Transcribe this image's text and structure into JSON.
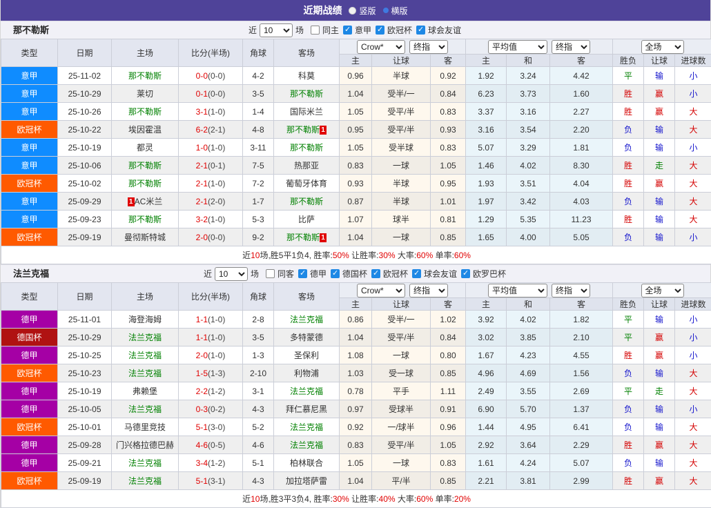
{
  "topbar": {
    "title": "近期战绩",
    "radios": [
      {
        "label": "竖版",
        "checked": false
      },
      {
        "label": "横版",
        "checked": true
      }
    ]
  },
  "colors": {
    "topbar_bg": "#4F4399",
    "comp": {
      "意甲": "#0F8CFF",
      "欧冠杯": "#FF5A00",
      "德甲": "#A500A5",
      "德国杯": "#B01212"
    },
    "win_red": "#D40000",
    "lose_blue": "#1414CC",
    "draw_green": "#008000",
    "focus_team_green": "#008000",
    "score_red": "#E00000",
    "checkbox_blue": "#1E88E5"
  },
  "table_header": {
    "cols": [
      "类型",
      "日期",
      "主场",
      "比分(半场)",
      "角球",
      "客场"
    ],
    "crow_selects": [
      "Crow*",
      "终指"
    ],
    "avg_selects": [
      "平均值",
      "终指"
    ],
    "scope_select": "全场",
    "sub": [
      "主",
      "让球",
      "客",
      "主",
      "和",
      "客",
      "胜负",
      "让球",
      "进球数"
    ]
  },
  "sections": [
    {
      "team": "那不勒斯",
      "filter": {
        "near_label": "近",
        "count": "10",
        "games_label": "场",
        "checkboxes": [
          {
            "label": "同主",
            "checked": false
          },
          {
            "label": "意甲",
            "checked": true
          },
          {
            "label": "欧冠杯",
            "checked": true
          },
          {
            "label": "球会友谊",
            "checked": true
          }
        ]
      },
      "rows": [
        {
          "comp": "意甲",
          "date": "25-11-02",
          "home": {
            "name": "那不勒斯",
            "focus": true
          },
          "score": "0-0",
          "half": "(0-0)",
          "corner": "4-2",
          "away": {
            "name": "科莫"
          },
          "crow": [
            "0.96",
            "半球",
            "0.92"
          ],
          "avg": [
            "1.92",
            "3.24",
            "4.42"
          ],
          "res": [
            [
              "平",
              "g"
            ],
            [
              "输",
              "b"
            ],
            [
              "小",
              "b"
            ]
          ]
        },
        {
          "comp": "意甲",
          "date": "25-10-29",
          "home": {
            "name": "莱切"
          },
          "score": "0-1",
          "half": "(0-0)",
          "corner": "3-5",
          "away": {
            "name": "那不勒斯",
            "focus": true
          },
          "crow": [
            "1.04",
            "受半/一",
            "0.84"
          ],
          "avg": [
            "6.23",
            "3.73",
            "1.60"
          ],
          "res": [
            [
              "胜",
              "r"
            ],
            [
              "赢",
              "r"
            ],
            [
              "小",
              "b"
            ]
          ]
        },
        {
          "comp": "意甲",
          "date": "25-10-26",
          "home": {
            "name": "那不勒斯",
            "focus": true
          },
          "score": "3-1",
          "half": "(1-0)",
          "corner": "1-4",
          "away": {
            "name": "国际米兰"
          },
          "crow": [
            "1.05",
            "受平/半",
            "0.83"
          ],
          "avg": [
            "3.37",
            "3.16",
            "2.27"
          ],
          "res": [
            [
              "胜",
              "r"
            ],
            [
              "赢",
              "r"
            ],
            [
              "大",
              "r"
            ]
          ]
        },
        {
          "comp": "欧冠杯",
          "date": "25-10-22",
          "home": {
            "name": "埃因霍温"
          },
          "score": "6-2",
          "half": "(2-1)",
          "corner": "4-8",
          "away": {
            "name": "那不勒斯",
            "focus": true,
            "card": "1",
            "card_pos": "right"
          },
          "crow": [
            "0.95",
            "受平/半",
            "0.93"
          ],
          "avg": [
            "3.16",
            "3.54",
            "2.20"
          ],
          "res": [
            [
              "负",
              "b"
            ],
            [
              "输",
              "b"
            ],
            [
              "大",
              "r"
            ]
          ]
        },
        {
          "comp": "意甲",
          "date": "25-10-19",
          "home": {
            "name": "都灵"
          },
          "score": "1-0",
          "half": "(1-0)",
          "corner": "3-11",
          "away": {
            "name": "那不勒斯",
            "focus": true
          },
          "crow": [
            "1.05",
            "受半球",
            "0.83"
          ],
          "avg": [
            "5.07",
            "3.29",
            "1.81"
          ],
          "res": [
            [
              "负",
              "b"
            ],
            [
              "输",
              "b"
            ],
            [
              "小",
              "b"
            ]
          ]
        },
        {
          "comp": "意甲",
          "date": "25-10-06",
          "home": {
            "name": "那不勒斯",
            "focus": true
          },
          "score": "2-1",
          "half": "(0-1)",
          "corner": "7-5",
          "away": {
            "name": "热那亚"
          },
          "crow": [
            "0.83",
            "一球",
            "1.05"
          ],
          "avg": [
            "1.46",
            "4.02",
            "8.30"
          ],
          "res": [
            [
              "胜",
              "r"
            ],
            [
              "走",
              "g"
            ],
            [
              "大",
              "r"
            ]
          ]
        },
        {
          "comp": "欧冠杯",
          "date": "25-10-02",
          "home": {
            "name": "那不勒斯",
            "focus": true
          },
          "score": "2-1",
          "half": "(1-0)",
          "corner": "7-2",
          "away": {
            "name": "葡萄牙体育"
          },
          "crow": [
            "0.93",
            "半球",
            "0.95"
          ],
          "avg": [
            "1.93",
            "3.51",
            "4.04"
          ],
          "res": [
            [
              "胜",
              "r"
            ],
            [
              "赢",
              "r"
            ],
            [
              "大",
              "r"
            ]
          ]
        },
        {
          "comp": "意甲",
          "date": "25-09-29",
          "home": {
            "name": "AC米兰",
            "card": "1",
            "card_pos": "left"
          },
          "score": "2-1",
          "half": "(2-0)",
          "corner": "1-7",
          "away": {
            "name": "那不勒斯",
            "focus": true
          },
          "crow": [
            "0.87",
            "半球",
            "1.01"
          ],
          "avg": [
            "1.97",
            "3.42",
            "4.03"
          ],
          "res": [
            [
              "负",
              "b"
            ],
            [
              "输",
              "b"
            ],
            [
              "大",
              "r"
            ]
          ]
        },
        {
          "comp": "意甲",
          "date": "25-09-23",
          "home": {
            "name": "那不勒斯",
            "focus": true
          },
          "score": "3-2",
          "half": "(1-0)",
          "corner": "5-3",
          "away": {
            "name": "比萨"
          },
          "crow": [
            "1.07",
            "球半",
            "0.81"
          ],
          "avg": [
            "1.29",
            "5.35",
            "11.23"
          ],
          "res": [
            [
              "胜",
              "r"
            ],
            [
              "输",
              "b"
            ],
            [
              "大",
              "r"
            ]
          ]
        },
        {
          "comp": "欧冠杯",
          "date": "25-09-19",
          "home": {
            "name": "曼彻斯特城"
          },
          "score": "2-0",
          "half": "(0-0)",
          "corner": "9-2",
          "away": {
            "name": "那不勒斯",
            "focus": true,
            "card": "1",
            "card_pos": "right"
          },
          "crow": [
            "1.04",
            "一球",
            "0.85"
          ],
          "avg": [
            "1.65",
            "4.00",
            "5.05"
          ],
          "res": [
            [
              "负",
              "b"
            ],
            [
              "输",
              "b"
            ],
            [
              "小",
              "b"
            ]
          ]
        }
      ],
      "summary": [
        {
          "t": "近"
        },
        {
          "t": "10",
          "r": true
        },
        {
          "t": "场,胜5平1负4, 胜率:"
        },
        {
          "t": "50%",
          "r": true
        },
        {
          "t": " 让胜率:"
        },
        {
          "t": "30%",
          "r": true
        },
        {
          "t": " 大率:"
        },
        {
          "t": "60%",
          "r": true
        },
        {
          "t": " 单率:"
        },
        {
          "t": "60%",
          "r": true
        }
      ]
    },
    {
      "team": "法兰克福",
      "filter": {
        "near_label": "近",
        "count": "10",
        "games_label": "场",
        "checkboxes": [
          {
            "label": "同客",
            "checked": false
          },
          {
            "label": "德甲",
            "checked": true
          },
          {
            "label": "德国杯",
            "checked": true
          },
          {
            "label": "欧冠杯",
            "checked": true
          },
          {
            "label": "球会友谊",
            "checked": true
          },
          {
            "label": "欧罗巴杯",
            "checked": true
          }
        ]
      },
      "rows": [
        {
          "comp": "德甲",
          "date": "25-11-01",
          "home": {
            "name": "海登海姆"
          },
          "score": "1-1",
          "half": "(1-0)",
          "corner": "2-8",
          "away": {
            "name": "法兰克福",
            "focus": true
          },
          "crow": [
            "0.86",
            "受半/一",
            "1.02"
          ],
          "avg": [
            "3.92",
            "4.02",
            "1.82"
          ],
          "res": [
            [
              "平",
              "g"
            ],
            [
              "输",
              "b"
            ],
            [
              "小",
              "b"
            ]
          ]
        },
        {
          "comp": "德国杯",
          "date": "25-10-29",
          "home": {
            "name": "法兰克福",
            "focus": true
          },
          "score": "1-1",
          "half": "(1-0)",
          "corner": "3-5",
          "away": {
            "name": "多特蒙德"
          },
          "crow": [
            "1.04",
            "受平/半",
            "0.84"
          ],
          "avg": [
            "3.02",
            "3.85",
            "2.10"
          ],
          "res": [
            [
              "平",
              "g"
            ],
            [
              "赢",
              "r"
            ],
            [
              "小",
              "b"
            ]
          ]
        },
        {
          "comp": "德甲",
          "date": "25-10-25",
          "home": {
            "name": "法兰克福",
            "focus": true
          },
          "score": "2-0",
          "half": "(1-0)",
          "corner": "1-3",
          "away": {
            "name": "圣保利"
          },
          "crow": [
            "1.08",
            "一球",
            "0.80"
          ],
          "avg": [
            "1.67",
            "4.23",
            "4.55"
          ],
          "res": [
            [
              "胜",
              "r"
            ],
            [
              "赢",
              "r"
            ],
            [
              "小",
              "b"
            ]
          ]
        },
        {
          "comp": "欧冠杯",
          "date": "25-10-23",
          "home": {
            "name": "法兰克福",
            "focus": true
          },
          "score": "1-5",
          "half": "(1-3)",
          "corner": "2-10",
          "away": {
            "name": "利物浦"
          },
          "crow": [
            "1.03",
            "受一球",
            "0.85"
          ],
          "avg": [
            "4.96",
            "4.69",
            "1.56"
          ],
          "res": [
            [
              "负",
              "b"
            ],
            [
              "输",
              "b"
            ],
            [
              "大",
              "r"
            ]
          ]
        },
        {
          "comp": "德甲",
          "date": "25-10-19",
          "home": {
            "name": "弗赖堡"
          },
          "score": "2-2",
          "half": "(1-2)",
          "corner": "3-1",
          "away": {
            "name": "法兰克福",
            "focus": true
          },
          "crow": [
            "0.78",
            "平手",
            "1.11"
          ],
          "avg": [
            "2.49",
            "3.55",
            "2.69"
          ],
          "res": [
            [
              "平",
              "g"
            ],
            [
              "走",
              "g"
            ],
            [
              "大",
              "r"
            ]
          ]
        },
        {
          "comp": "德甲",
          "date": "25-10-05",
          "home": {
            "name": "法兰克福",
            "focus": true
          },
          "score": "0-3",
          "half": "(0-2)",
          "corner": "4-3",
          "away": {
            "name": "拜仁慕尼黑"
          },
          "crow": [
            "0.97",
            "受球半",
            "0.91"
          ],
          "avg": [
            "6.90",
            "5.70",
            "1.37"
          ],
          "res": [
            [
              "负",
              "b"
            ],
            [
              "输",
              "b"
            ],
            [
              "小",
              "b"
            ]
          ]
        },
        {
          "comp": "欧冠杯",
          "date": "25-10-01",
          "home": {
            "name": "马德里竞技"
          },
          "score": "5-1",
          "half": "(3-0)",
          "corner": "5-2",
          "away": {
            "name": "法兰克福",
            "focus": true
          },
          "crow": [
            "0.92",
            "一/球半",
            "0.96"
          ],
          "avg": [
            "1.44",
            "4.95",
            "6.41"
          ],
          "res": [
            [
              "负",
              "b"
            ],
            [
              "输",
              "b"
            ],
            [
              "大",
              "r"
            ]
          ]
        },
        {
          "comp": "德甲",
          "date": "25-09-28",
          "home": {
            "name": "门兴格拉德巴赫"
          },
          "score": "4-6",
          "half": "(0-5)",
          "corner": "4-6",
          "away": {
            "name": "法兰克福",
            "focus": true
          },
          "crow": [
            "0.83",
            "受平/半",
            "1.05"
          ],
          "avg": [
            "2.92",
            "3.64",
            "2.29"
          ],
          "res": [
            [
              "胜",
              "r"
            ],
            [
              "赢",
              "r"
            ],
            [
              "大",
              "r"
            ]
          ]
        },
        {
          "comp": "德甲",
          "date": "25-09-21",
          "home": {
            "name": "法兰克福",
            "focus": true
          },
          "score": "3-4",
          "half": "(1-2)",
          "corner": "5-1",
          "away": {
            "name": "柏林联合"
          },
          "crow": [
            "1.05",
            "一球",
            "0.83"
          ],
          "avg": [
            "1.61",
            "4.24",
            "5.07"
          ],
          "res": [
            [
              "负",
              "b"
            ],
            [
              "输",
              "b"
            ],
            [
              "大",
              "r"
            ]
          ]
        },
        {
          "comp": "欧冠杯",
          "date": "25-09-19",
          "home": {
            "name": "法兰克福",
            "focus": true
          },
          "score": "5-1",
          "half": "(3-1)",
          "corner": "4-3",
          "away": {
            "name": "加拉塔萨雷"
          },
          "crow": [
            "1.04",
            "平/半",
            "0.85"
          ],
          "avg": [
            "2.21",
            "3.81",
            "2.99"
          ],
          "res": [
            [
              "胜",
              "r"
            ],
            [
              "赢",
              "r"
            ],
            [
              "大",
              "r"
            ]
          ]
        }
      ],
      "summary": [
        {
          "t": "近"
        },
        {
          "t": "10",
          "r": true
        },
        {
          "t": "场,胜3平3负4, 胜率:"
        },
        {
          "t": "30%",
          "r": true
        },
        {
          "t": " 让胜率:"
        },
        {
          "t": "40%",
          "r": true
        },
        {
          "t": " 大率:"
        },
        {
          "t": "60%",
          "r": true
        },
        {
          "t": " 单率:"
        },
        {
          "t": "20%",
          "r": true
        }
      ]
    }
  ]
}
